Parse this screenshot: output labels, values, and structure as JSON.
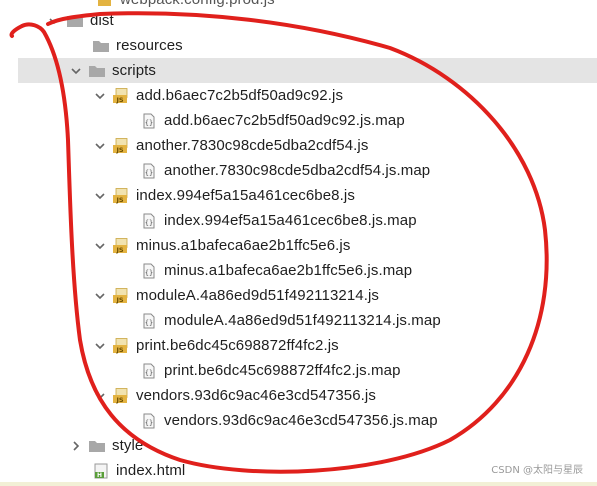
{
  "tree": {
    "clipped_top": "webpack.config.prod.js",
    "dist": "dist",
    "resources": "resources",
    "scripts": "scripts",
    "files": [
      {
        "js": "add.b6aec7c2b5df50ad9c92.js",
        "map": "add.b6aec7c2b5df50ad9c92.js.map"
      },
      {
        "js": "another.7830c98cde5dba2cdf54.js",
        "map": "another.7830c98cde5dba2cdf54.js.map"
      },
      {
        "js": "index.994ef5a15a461cec6be8.js",
        "map": "index.994ef5a15a461cec6be8.js.map"
      },
      {
        "js": "minus.a1bafeca6ae2b1ffc5e6.js",
        "map": "minus.a1bafeca6ae2b1ffc5e6.js.map"
      },
      {
        "js": "moduleA.4a86ed9d51f492113214.js",
        "map": "moduleA.4a86ed9d51f492113214.js.map"
      },
      {
        "js": "print.be6dc45c698872ff4fc2.js",
        "map": "print.be6dc45c698872ff4fc2.js.map"
      },
      {
        "js": "vendors.93d6c9ac46e3cd547356.js",
        "map": "vendors.93d6c9ac46e3cd547356.js.map"
      }
    ],
    "style": "style",
    "index_html": "index.html"
  },
  "icons": {
    "js_badge": "JS",
    "map_badge": "{}",
    "html_badge": "H"
  },
  "watermark": "CSDN @太阳与星辰",
  "colors": {
    "folder": "#a8a8a8",
    "js_icon": "#e3b341",
    "annotation": "#e0201c",
    "selection": "#e4e4e4"
  }
}
